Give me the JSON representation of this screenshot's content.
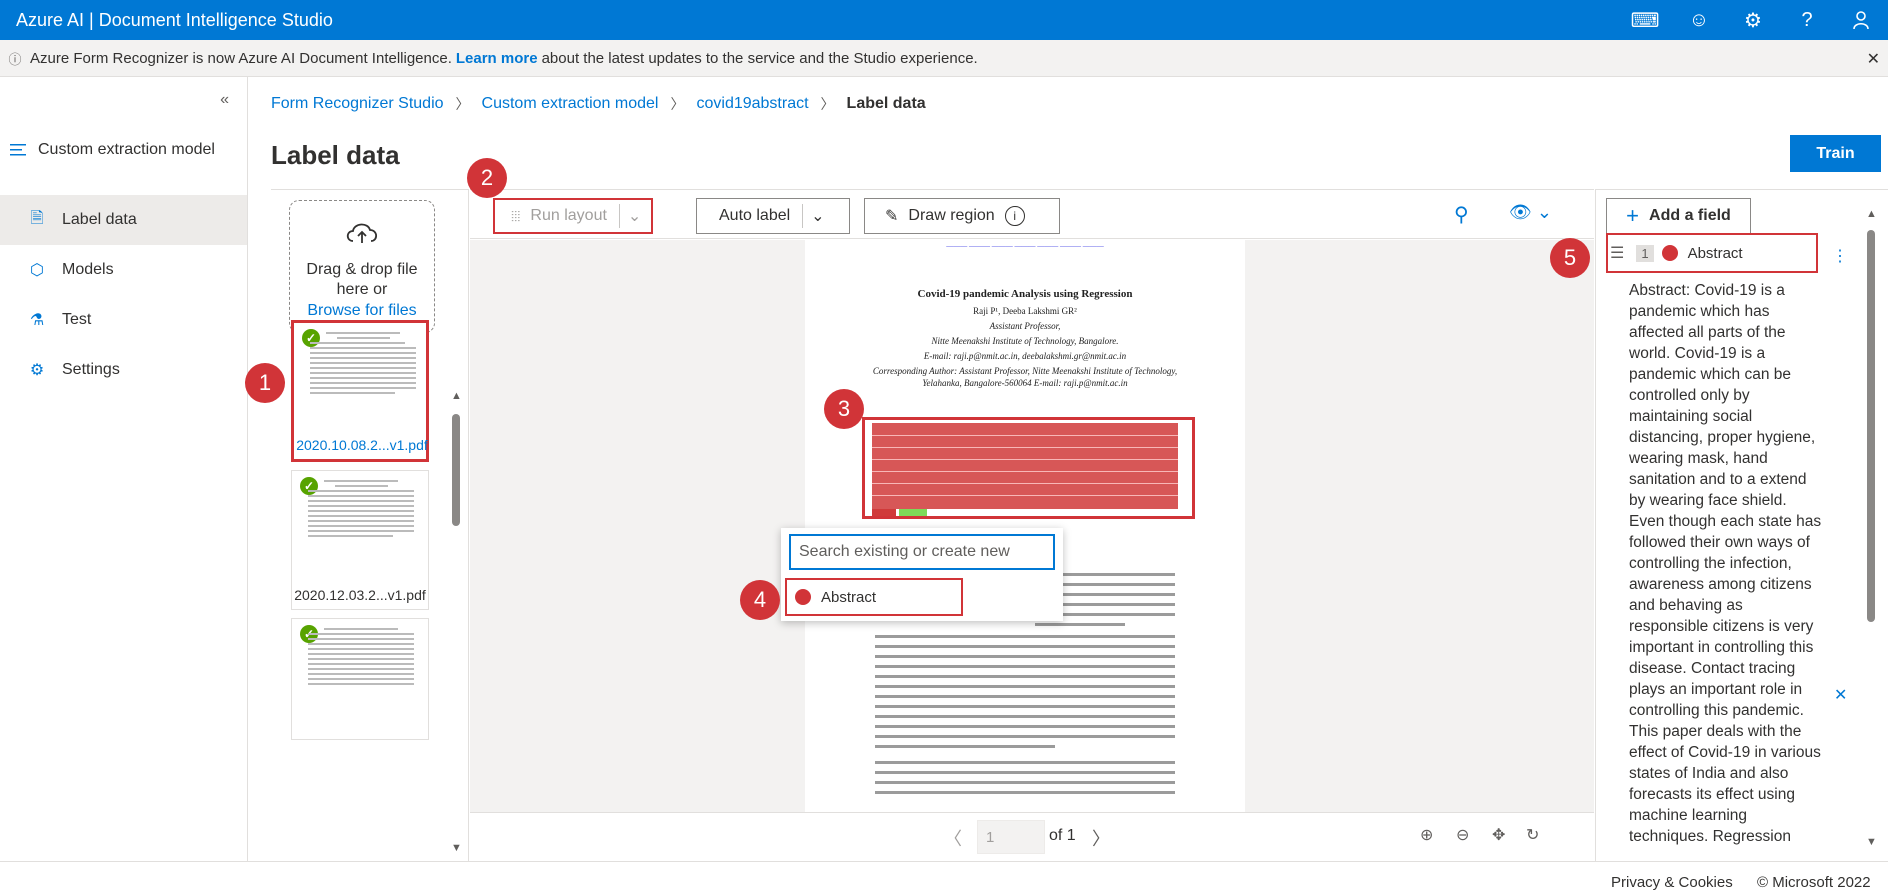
{
  "app": {
    "title": "Azure AI | Document Intelligence Studio"
  },
  "topbar_icons": [
    "keyboard-icon",
    "feedback-icon",
    "settings-icon",
    "help-icon",
    "account-icon"
  ],
  "banner": {
    "text_before": "Azure Form Recognizer is now Azure AI Document Intelligence.",
    "link": "Learn more",
    "text_after": "about the latest updates to the service and the Studio experience."
  },
  "nav": {
    "model_type": "Custom extraction model",
    "project": "covid19abstract",
    "items": [
      {
        "label": "Label data",
        "icon": "document-icon",
        "active": true
      },
      {
        "label": "Models",
        "icon": "cube-icon",
        "active": false
      },
      {
        "label": "Test",
        "icon": "flask-icon",
        "active": false
      },
      {
        "label": "Settings",
        "icon": "settings-icon",
        "active": false
      }
    ]
  },
  "breadcrumb": [
    "Form Recognizer Studio",
    "Custom extraction model",
    "covid19abstract",
    "Label data"
  ],
  "page_title": "Label data",
  "train_label": "Train",
  "dropzone": {
    "line1": "Drag & drop file here or",
    "browse": "Browse for files"
  },
  "files": [
    {
      "name": "2020.10.08.2...v1.pdf",
      "selected": true,
      "labeled": true
    },
    {
      "name": "2020.12.03.2...v1.pdf",
      "selected": false,
      "labeled": true
    },
    {
      "name": "",
      "selected": false,
      "labeled": true
    }
  ],
  "toolbar": {
    "run_layout": "Run layout",
    "auto_label": "Auto label",
    "draw_region": "Draw region"
  },
  "document": {
    "title": "Covid-19 pandemic Analysis using Regression",
    "authors": "Raji P¹, Deeba Lakshmi GR²",
    "role": "Assistant Professor,",
    "institute": "Nitte Meenakshi Institute of Technology, Bangalore.",
    "emails": "E-mail: raji.p@nmit.ac.in, deebalakshmi.gr@nmit.ac.in",
    "corresponding": "Corresponding Author: Assistant Professor, Nitte Meenakshi Institute of Technology,",
    "address": "Yelahanka, Bangalore-560064 E-mail: raji.p@nmit.ac.in"
  },
  "popup": {
    "placeholder": "Search existing or create new",
    "option": "Abstract"
  },
  "pager": {
    "page": "1",
    "of": "of 1"
  },
  "fields_panel": {
    "add_field": "Add a field",
    "field_index": "1",
    "field_name": "Abstract",
    "field_color": "#d13438",
    "field_value": "Abstract: Covid-19 is a pandemic which has affected all parts of the world. Covid-19 is a pandemic which can be controlled only by maintaining social distancing, proper hygiene, wearing mask, hand sanitation and to a extend by wearing face shield. Even though each state has followed their own ways of controlling the infection, awareness among citizens and behaving as responsible citizens is very important in controlling this disease. Contact tracing plays an important role in controlling this pandemic. This paper deals with the effect of Covid-19 in various states of India and also forecasts its effect using machine learning techniques. Regression"
  },
  "footer": {
    "privacy": "Privacy & Cookies",
    "copyright": "© Microsoft 2022"
  },
  "callouts": [
    "1",
    "2",
    "3",
    "4",
    "5"
  ],
  "colors": {
    "brand": "#0078d4",
    "annotation": "#d13438",
    "labeled": "#57a300"
  }
}
